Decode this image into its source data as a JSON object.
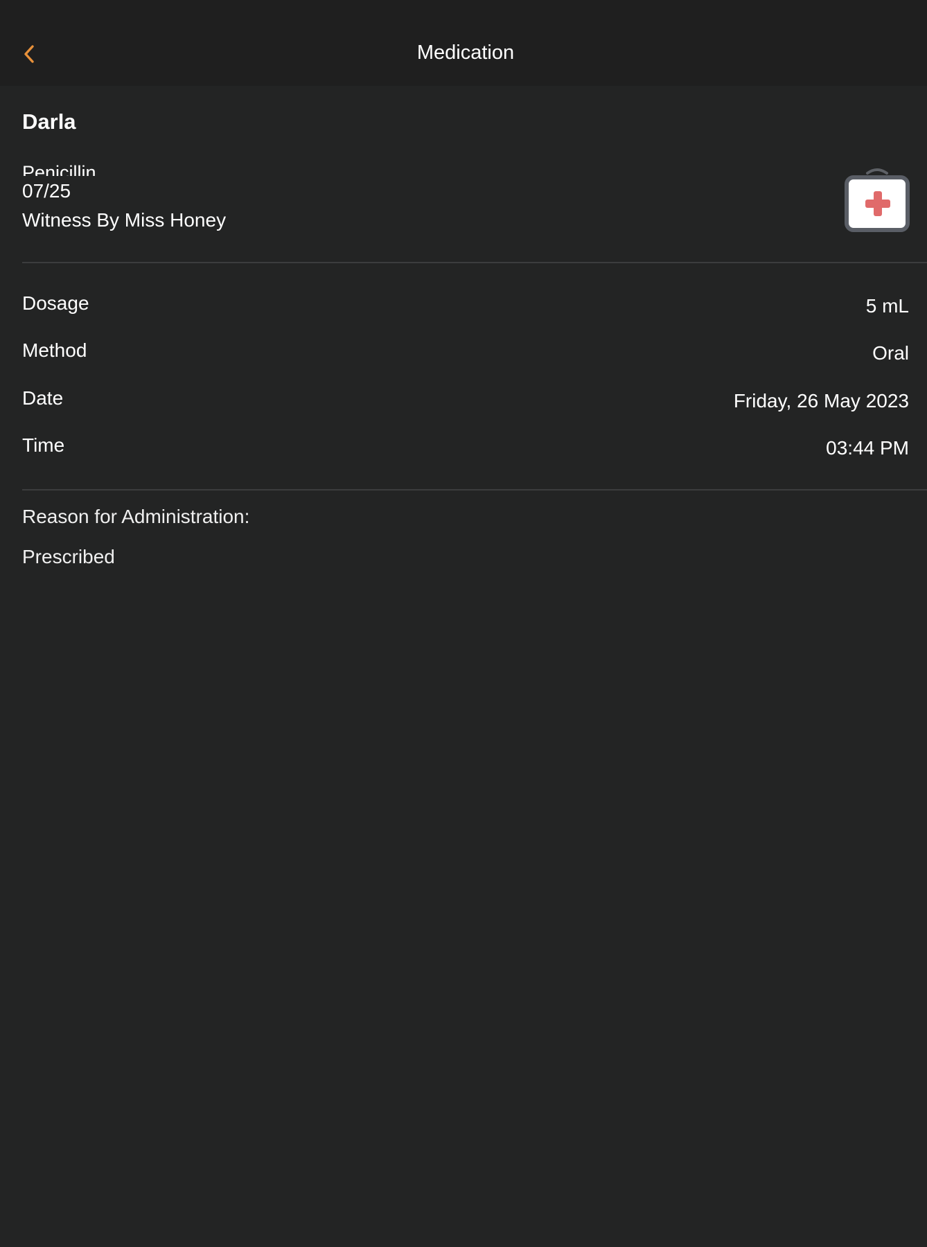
{
  "nav": {
    "title": "Medication",
    "accent_color": "#E8913A"
  },
  "record": {
    "patient_name": "Darla",
    "medication_name": "Penicillin",
    "date_short": "07/25",
    "witness": "Witness By Miss Honey",
    "icon": "first-aid-kit-icon"
  },
  "details": [
    {
      "label": "Dosage",
      "value": "5 mL"
    },
    {
      "label": "Method",
      "value": "Oral"
    },
    {
      "label": "Date",
      "value": "Friday, 26 May 2023"
    },
    {
      "label": "Time",
      "value": "03:44 PM"
    }
  ],
  "reason": {
    "heading": "Reason for Administration:",
    "value": "Prescribed"
  }
}
